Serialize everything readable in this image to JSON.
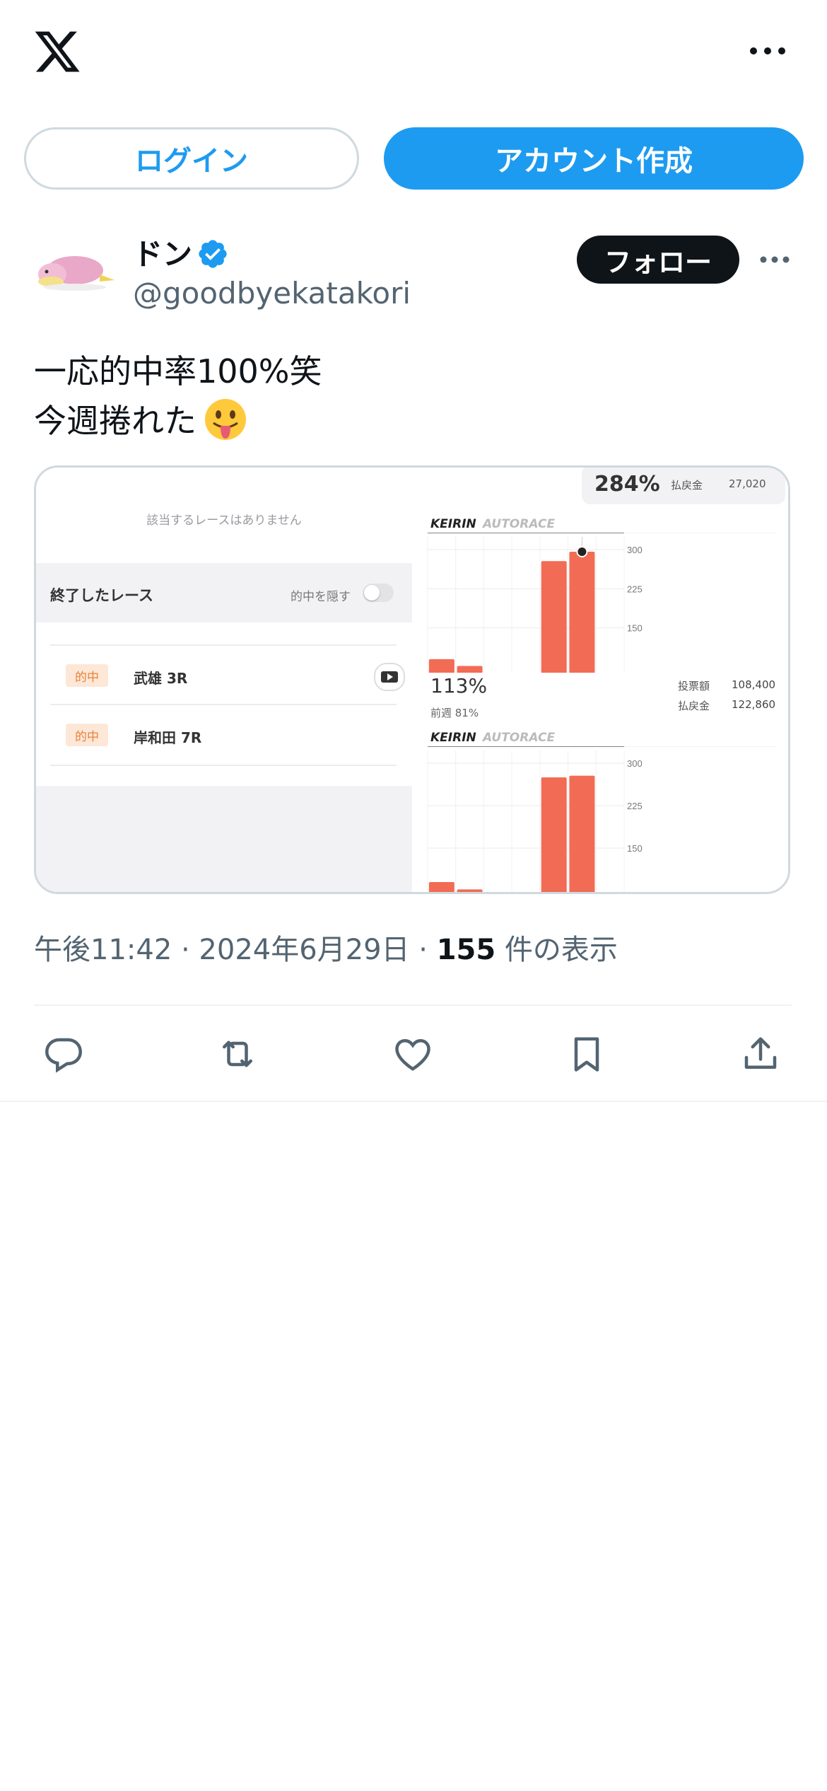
{
  "header": {
    "logo_icon": "x-logo-icon",
    "more_icon": "more-dots-icon"
  },
  "auth": {
    "login_label": "ログイン",
    "signup_label": "アカウント作成"
  },
  "post": {
    "author_name": "ドン",
    "verified_icon": "verified-badge-icon",
    "handle": "@goodbyekatakori",
    "follow_label": "フォロー",
    "text": "一応的中率100%笑\n今週捲れた",
    "emoji_icon": "tongue-out-emoji-icon",
    "meta_prefix": "午後11:42 · 2024年6月29日 · ",
    "views_count": "155",
    "views_suffix": " 件の表示"
  },
  "media": {
    "no_races": "該当するレースはありません",
    "ended_races": "終了したレース",
    "hide_hits": "的中を隠す",
    "rows": [
      {
        "badge": "的中",
        "race": "武雄 3R"
      },
      {
        "badge": "的中",
        "race": "岸和田 7R"
      }
    ],
    "top_percent": "284%",
    "payout_label": "払戻金",
    "payout_top": "27,020",
    "tab_keirin": "KEIRIN",
    "tab_autorace": "AUTORACE",
    "percent2": "113%",
    "prev_week": "前週 81%",
    "bet_label": "投票額",
    "bet_value": "108,400",
    "payout_label2": "払戻金",
    "payout_value": "122,860",
    "chart_color": "#f26b55"
  },
  "chart_data": [
    {
      "type": "bar",
      "title": "",
      "ylim": [
        75,
        300
      ],
      "ticks": [
        "300",
        "225",
        "150"
      ],
      "values": [
        90,
        77,
        278,
        296
      ],
      "highlight_index": 3
    },
    {
      "type": "bar",
      "title": "",
      "ylim": [
        75,
        300
      ],
      "ticks": [
        "300",
        "225",
        "150"
      ],
      "values": [
        90,
        77,
        275,
        278
      ]
    }
  ],
  "actions": [
    "reply-icon",
    "repost-icon",
    "like-icon",
    "bookmark-icon",
    "share-icon"
  ]
}
